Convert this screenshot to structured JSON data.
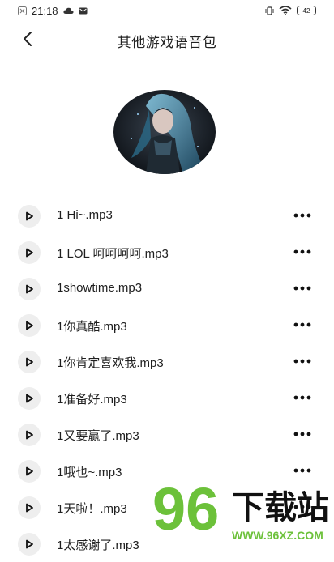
{
  "status_bar": {
    "time": "21:18",
    "battery": "42",
    "icons": [
      "notification-icon",
      "cloud-icon",
      "message-icon",
      "vibrate-icon",
      "wifi-icon",
      "battery-icon"
    ]
  },
  "nav": {
    "back_icon": "chevron-left-icon",
    "title": "其他游戏语音包"
  },
  "sounds": [
    {
      "name": "1 Hi~.mp3"
    },
    {
      "name": "1 LOL 呵呵呵呵.mp3"
    },
    {
      "name": "1showtime.mp3"
    },
    {
      "name": "1你真酷.mp3"
    },
    {
      "name": "1你肯定喜欢我.mp3"
    },
    {
      "name": "1准备好.mp3"
    },
    {
      "name": "1又要赢了.mp3"
    },
    {
      "name": "1哦也~.mp3"
    },
    {
      "name": "1天啦！.mp3"
    },
    {
      "name": "1太感谢了.mp3"
    }
  ],
  "watermark": {
    "logo_digits": "96",
    "logo_text": "下载站",
    "logo_url": "WWW.96XZ.COM",
    "colors": {
      "green": "#6cc13a",
      "black": "#111111"
    }
  }
}
